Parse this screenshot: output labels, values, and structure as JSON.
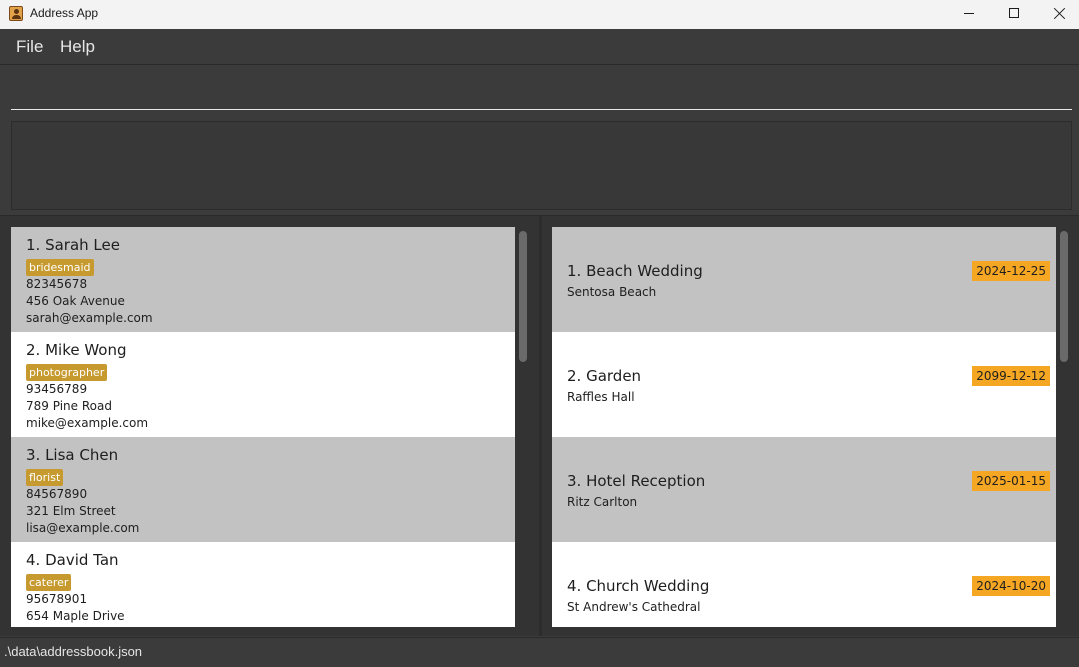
{
  "window": {
    "title": "Address App"
  },
  "menu": {
    "file": "File",
    "help": "Help"
  },
  "command": {
    "value": ""
  },
  "persons": [
    {
      "name": "1. Sarah Lee",
      "tag": "bridesmaid",
      "phone": "82345678",
      "address": "456 Oak Avenue",
      "email": "sarah@example.com"
    },
    {
      "name": "2. Mike Wong",
      "tag": "photographer",
      "phone": "93456789",
      "address": "789 Pine Road",
      "email": "mike@example.com"
    },
    {
      "name": "3. Lisa Chen",
      "tag": "florist",
      "phone": "84567890",
      "address": "321 Elm Street",
      "email": "lisa@example.com"
    },
    {
      "name": "4. David Tan",
      "tag": "caterer",
      "phone": "95678901",
      "address": "654 Maple Drive",
      "email": ""
    }
  ],
  "events": [
    {
      "name": "1. Beach Wedding",
      "location": "Sentosa Beach",
      "date": "2024-12-25"
    },
    {
      "name": "2. Garden",
      "location": "Raffles Hall",
      "date": "2099-12-12"
    },
    {
      "name": "3. Hotel Reception",
      "location": "Ritz Carlton",
      "date": "2025-01-15"
    },
    {
      "name": "4. Church Wedding",
      "location": "St Andrew's Cathedral",
      "date": "2024-10-20"
    }
  ],
  "status": {
    "file_path": ".\\data\\addressbook.json"
  },
  "colors": {
    "tag": "#c69a2e",
    "date_badge": "#f5a623",
    "card_alt": "#c2c2c2"
  }
}
